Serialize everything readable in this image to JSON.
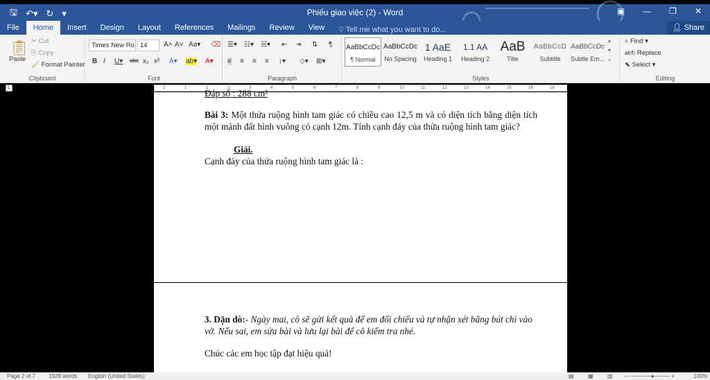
{
  "window": {
    "title": "Phiếu giao việc (2) - Word",
    "accent_color": "#2b579a"
  },
  "tabs": [
    {
      "label": "File"
    },
    {
      "label": "Home"
    },
    {
      "label": "Insert"
    },
    {
      "label": "Design"
    },
    {
      "label": "Layout"
    },
    {
      "label": "References"
    },
    {
      "label": "Mailings"
    },
    {
      "label": "Review"
    },
    {
      "label": "View"
    }
  ],
  "tell_me": "Tell me what you want to do...",
  "share": "Share",
  "clipboard": {
    "paste": "Paste",
    "cut": "Cut",
    "copy": "Copy",
    "format_painter": "Format Painter",
    "label": "Clipboard"
  },
  "font": {
    "name": "Times New Ro",
    "size": "14",
    "label": "Font"
  },
  "paragraph": {
    "label": "Paragraph"
  },
  "styles": {
    "label": "Styles",
    "items": [
      {
        "preview": "AaBbCcDc",
        "name": "¶ Normal"
      },
      {
        "preview": "AaBbCcDc",
        "name": "No Spacing"
      },
      {
        "preview": "1 AaE",
        "name": "Heading 1"
      },
      {
        "preview": "1.1 AA",
        "name": "Heading 2"
      },
      {
        "preview": "AaB",
        "name": "Title"
      },
      {
        "preview": "AaBbCcD",
        "name": "Subtitle"
      },
      {
        "preview": "AaBbCcDc",
        "name": "Subtle Em..."
      }
    ]
  },
  "editing": {
    "find": "Find",
    "replace": "Replace",
    "select": "Select",
    "label": "Editing"
  },
  "ruler_marks": [
    "2",
    "1",
    "1",
    "2",
    "3",
    "4",
    "5",
    "6",
    "7",
    "8",
    "9",
    "10",
    "11",
    "12",
    "13",
    "14",
    "15",
    "16",
    "18"
  ],
  "page1": {
    "top_partial": "Đáp số : 288 cm²",
    "bai3_label": "Bài 3:",
    "bai3_text": " Một thửa ruộng hình tam giác có chiều cao 12,5 m và có diện tích bằng diện tích một mảnh đất hình vuông có cạnh 12m. Tính cạnh đáy của thửa ruộng hình tam giác?",
    "giai": "Giải.",
    "canh_day": "Cạnh đáy của thửa ruộng hình tam giác là :"
  },
  "page2": {
    "dando_label": "3. Dặn dò:",
    "dando_text": "- Ngày mai, cô sẽ gửi kết quả để em đối chiếu và tự nhận xét bằng bút chì vào vở. Nếu sai, em sửa bài và lưu lại bài để cô kiểm tra nhé.",
    "closing": "Chúc các em học tập đạt hiệu quả!"
  },
  "status": {
    "page": "Page 2 of 7",
    "words": "1928 words",
    "language": "English (United States)",
    "zoom": "100%"
  }
}
